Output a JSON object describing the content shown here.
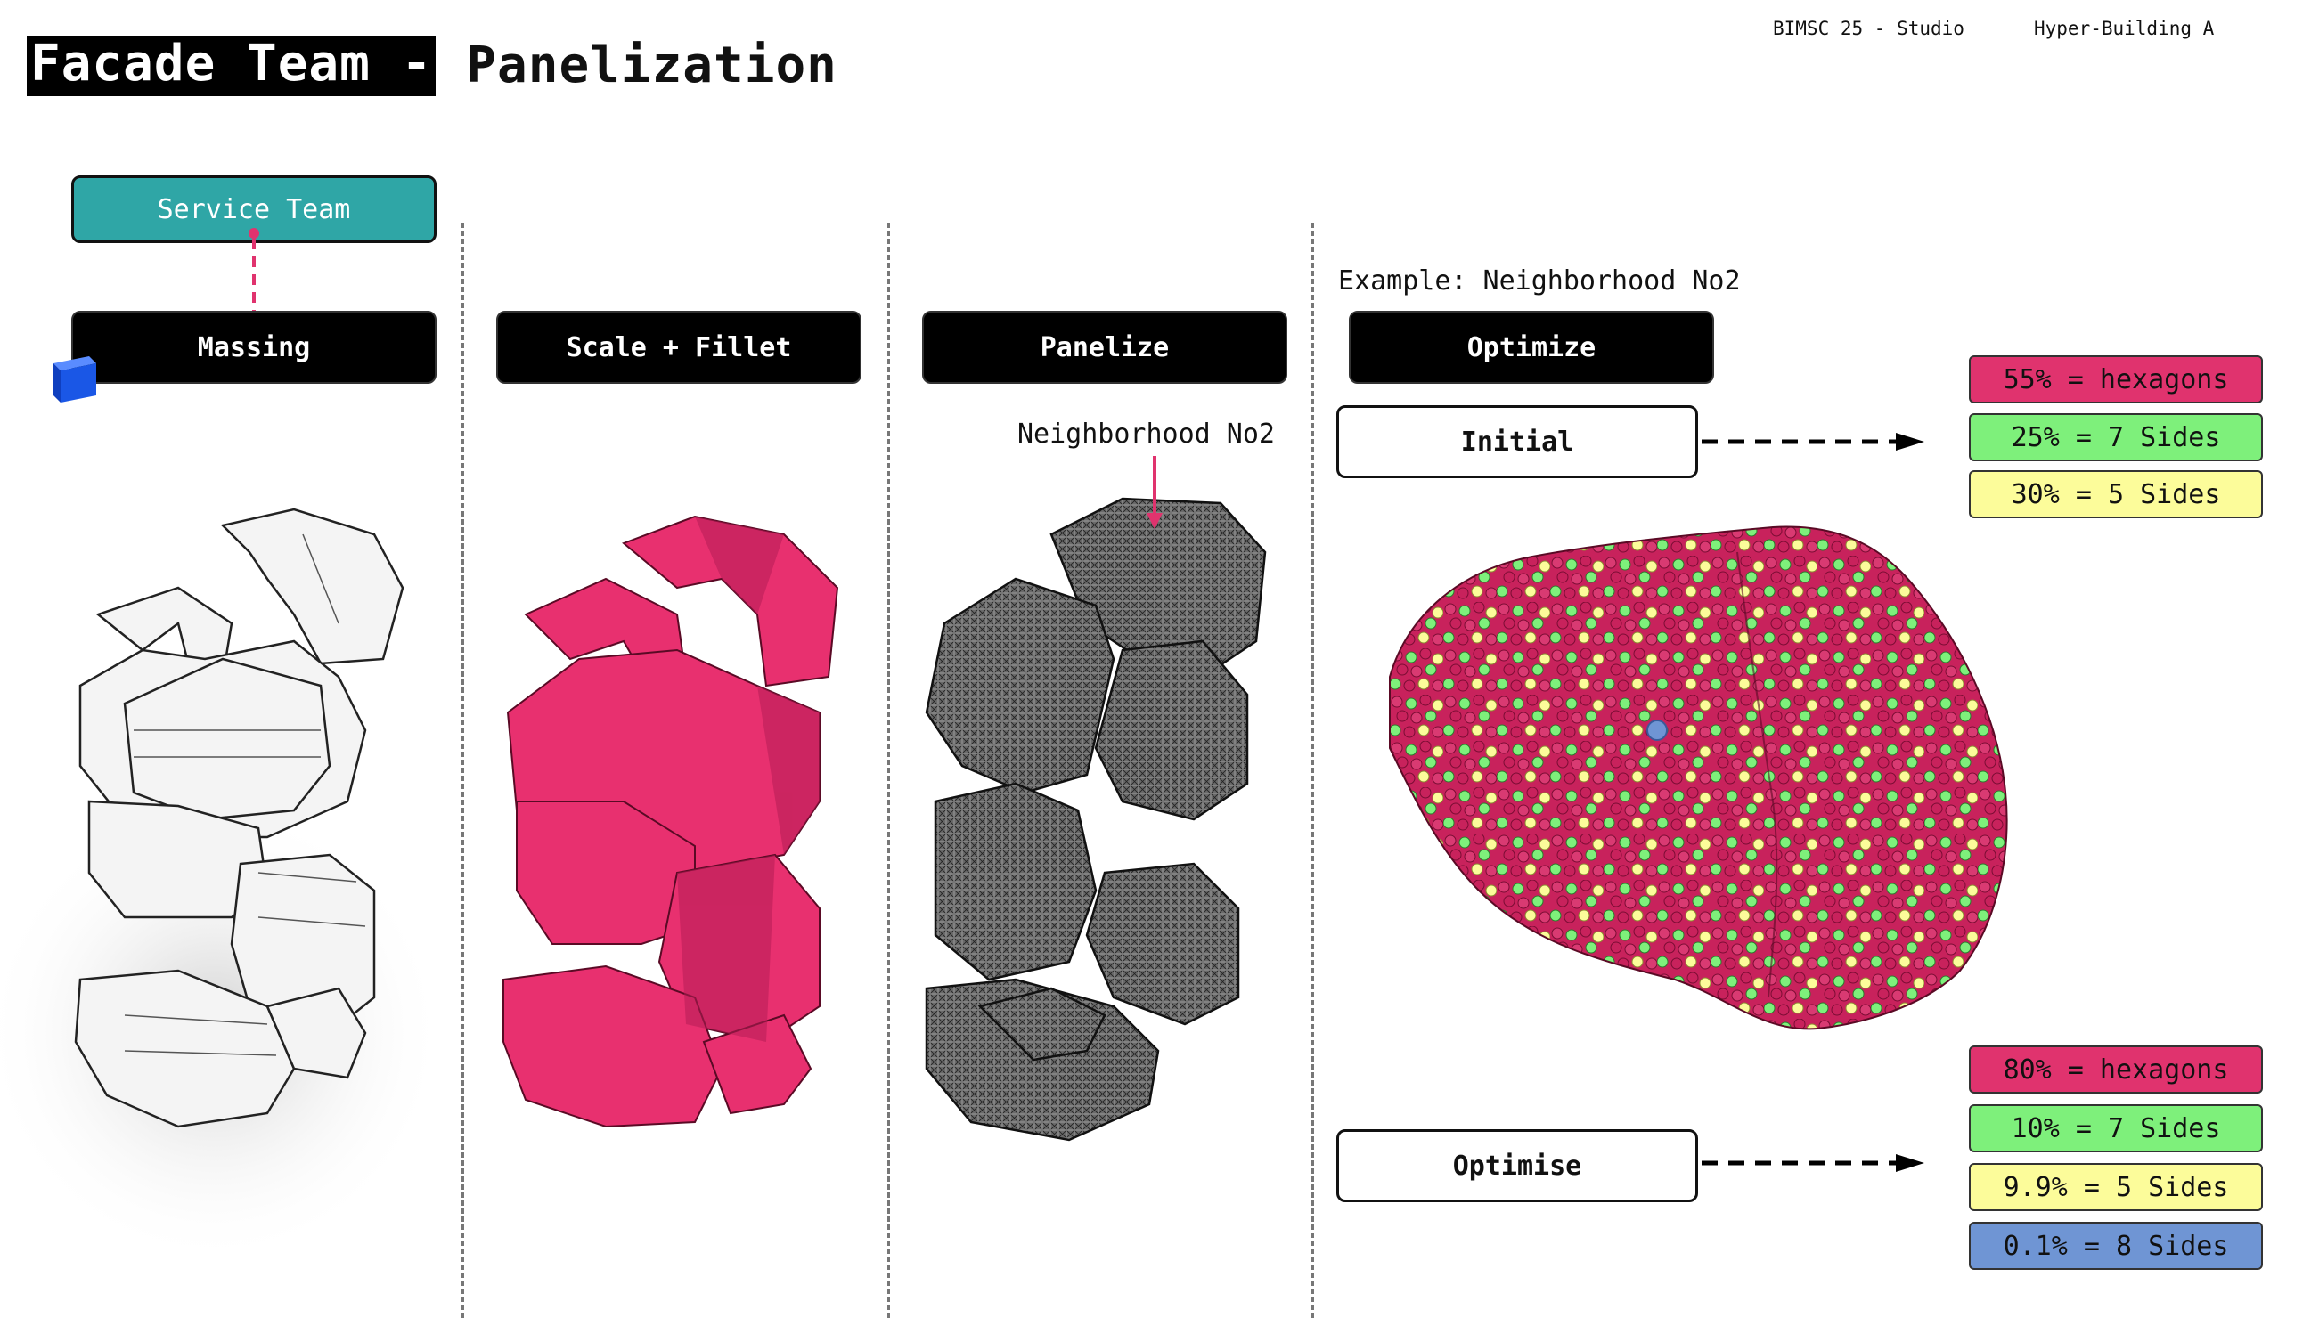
{
  "header": {
    "title_highlight": "Facade Team -",
    "title_rest": "Panelization",
    "course": "BIMSC 25 - Studio",
    "project": "Hyper-Building A"
  },
  "service_team": {
    "label": "Service Team"
  },
  "steps": [
    {
      "label": "Massing"
    },
    {
      "label": "Scale + Fillet"
    },
    {
      "label": "Panelize"
    },
    {
      "label": "Optimize"
    }
  ],
  "panelize_annotation": "Neighborhood No2",
  "example_label": "Example: Neighborhood No2",
  "initial": {
    "label": "Initial",
    "stats": [
      {
        "text": "55% = hexagons",
        "color": "#e0336e"
      },
      {
        "text": "25% = 7 Sides",
        "color": "#7ef07b"
      },
      {
        "text": "30% = 5 Sides",
        "color": "#fcfc9a"
      }
    ]
  },
  "optimise": {
    "label": "Optimise",
    "stats": [
      {
        "text": "80% = hexagons",
        "color": "#e0336e"
      },
      {
        "text": "10% = 7 Sides",
        "color": "#7ef07b"
      },
      {
        "text": "9.9% = 5 Sides",
        "color": "#fcfc9a"
      },
      {
        "text": "0.1% = 8 Sides",
        "color": "#6f95d4"
      }
    ]
  },
  "colors": {
    "teal": "#2fa6a6",
    "pink": "#e8306f",
    "green": "#7ef07b",
    "yellow": "#fcfc9a",
    "blue": "#6f95d4",
    "cube_blue": "#1a57e6"
  }
}
